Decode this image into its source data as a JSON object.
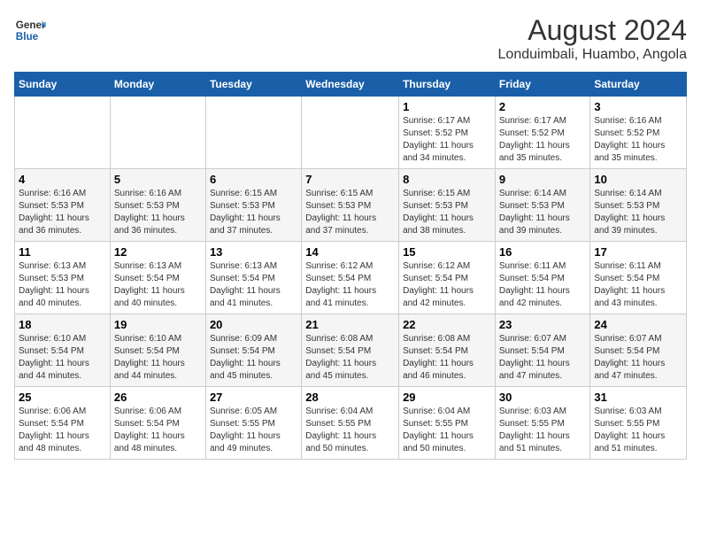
{
  "header": {
    "logo": {
      "general": "General",
      "blue": "Blue"
    },
    "title": "August 2024",
    "subtitle": "Londuimbali, Huambo, Angola"
  },
  "calendar": {
    "days_of_week": [
      "Sunday",
      "Monday",
      "Tuesday",
      "Wednesday",
      "Thursday",
      "Friday",
      "Saturday"
    ],
    "weeks": [
      [
        {
          "day": "",
          "detail": ""
        },
        {
          "day": "",
          "detail": ""
        },
        {
          "day": "",
          "detail": ""
        },
        {
          "day": "",
          "detail": ""
        },
        {
          "day": "1",
          "detail": "Sunrise: 6:17 AM\nSunset: 5:52 PM\nDaylight: 11 hours\nand 34 minutes."
        },
        {
          "day": "2",
          "detail": "Sunrise: 6:17 AM\nSunset: 5:52 PM\nDaylight: 11 hours\nand 35 minutes."
        },
        {
          "day": "3",
          "detail": "Sunrise: 6:16 AM\nSunset: 5:52 PM\nDaylight: 11 hours\nand 35 minutes."
        }
      ],
      [
        {
          "day": "4",
          "detail": "Sunrise: 6:16 AM\nSunset: 5:53 PM\nDaylight: 11 hours\nand 36 minutes."
        },
        {
          "day": "5",
          "detail": "Sunrise: 6:16 AM\nSunset: 5:53 PM\nDaylight: 11 hours\nand 36 minutes."
        },
        {
          "day": "6",
          "detail": "Sunrise: 6:15 AM\nSunset: 5:53 PM\nDaylight: 11 hours\nand 37 minutes."
        },
        {
          "day": "7",
          "detail": "Sunrise: 6:15 AM\nSunset: 5:53 PM\nDaylight: 11 hours\nand 37 minutes."
        },
        {
          "day": "8",
          "detail": "Sunrise: 6:15 AM\nSunset: 5:53 PM\nDaylight: 11 hours\nand 38 minutes."
        },
        {
          "day": "9",
          "detail": "Sunrise: 6:14 AM\nSunset: 5:53 PM\nDaylight: 11 hours\nand 39 minutes."
        },
        {
          "day": "10",
          "detail": "Sunrise: 6:14 AM\nSunset: 5:53 PM\nDaylight: 11 hours\nand 39 minutes."
        }
      ],
      [
        {
          "day": "11",
          "detail": "Sunrise: 6:13 AM\nSunset: 5:53 PM\nDaylight: 11 hours\nand 40 minutes."
        },
        {
          "day": "12",
          "detail": "Sunrise: 6:13 AM\nSunset: 5:54 PM\nDaylight: 11 hours\nand 40 minutes."
        },
        {
          "day": "13",
          "detail": "Sunrise: 6:13 AM\nSunset: 5:54 PM\nDaylight: 11 hours\nand 41 minutes."
        },
        {
          "day": "14",
          "detail": "Sunrise: 6:12 AM\nSunset: 5:54 PM\nDaylight: 11 hours\nand 41 minutes."
        },
        {
          "day": "15",
          "detail": "Sunrise: 6:12 AM\nSunset: 5:54 PM\nDaylight: 11 hours\nand 42 minutes."
        },
        {
          "day": "16",
          "detail": "Sunrise: 6:11 AM\nSunset: 5:54 PM\nDaylight: 11 hours\nand 42 minutes."
        },
        {
          "day": "17",
          "detail": "Sunrise: 6:11 AM\nSunset: 5:54 PM\nDaylight: 11 hours\nand 43 minutes."
        }
      ],
      [
        {
          "day": "18",
          "detail": "Sunrise: 6:10 AM\nSunset: 5:54 PM\nDaylight: 11 hours\nand 44 minutes."
        },
        {
          "day": "19",
          "detail": "Sunrise: 6:10 AM\nSunset: 5:54 PM\nDaylight: 11 hours\nand 44 minutes."
        },
        {
          "day": "20",
          "detail": "Sunrise: 6:09 AM\nSunset: 5:54 PM\nDaylight: 11 hours\nand 45 minutes."
        },
        {
          "day": "21",
          "detail": "Sunrise: 6:08 AM\nSunset: 5:54 PM\nDaylight: 11 hours\nand 45 minutes."
        },
        {
          "day": "22",
          "detail": "Sunrise: 6:08 AM\nSunset: 5:54 PM\nDaylight: 11 hours\nand 46 minutes."
        },
        {
          "day": "23",
          "detail": "Sunrise: 6:07 AM\nSunset: 5:54 PM\nDaylight: 11 hours\nand 47 minutes."
        },
        {
          "day": "24",
          "detail": "Sunrise: 6:07 AM\nSunset: 5:54 PM\nDaylight: 11 hours\nand 47 minutes."
        }
      ],
      [
        {
          "day": "25",
          "detail": "Sunrise: 6:06 AM\nSunset: 5:54 PM\nDaylight: 11 hours\nand 48 minutes."
        },
        {
          "day": "26",
          "detail": "Sunrise: 6:06 AM\nSunset: 5:54 PM\nDaylight: 11 hours\nand 48 minutes."
        },
        {
          "day": "27",
          "detail": "Sunrise: 6:05 AM\nSunset: 5:55 PM\nDaylight: 11 hours\nand 49 minutes."
        },
        {
          "day": "28",
          "detail": "Sunrise: 6:04 AM\nSunset: 5:55 PM\nDaylight: 11 hours\nand 50 minutes."
        },
        {
          "day": "29",
          "detail": "Sunrise: 6:04 AM\nSunset: 5:55 PM\nDaylight: 11 hours\nand 50 minutes."
        },
        {
          "day": "30",
          "detail": "Sunrise: 6:03 AM\nSunset: 5:55 PM\nDaylight: 11 hours\nand 51 minutes."
        },
        {
          "day": "31",
          "detail": "Sunrise: 6:03 AM\nSunset: 5:55 PM\nDaylight: 11 hours\nand 51 minutes."
        }
      ]
    ]
  }
}
